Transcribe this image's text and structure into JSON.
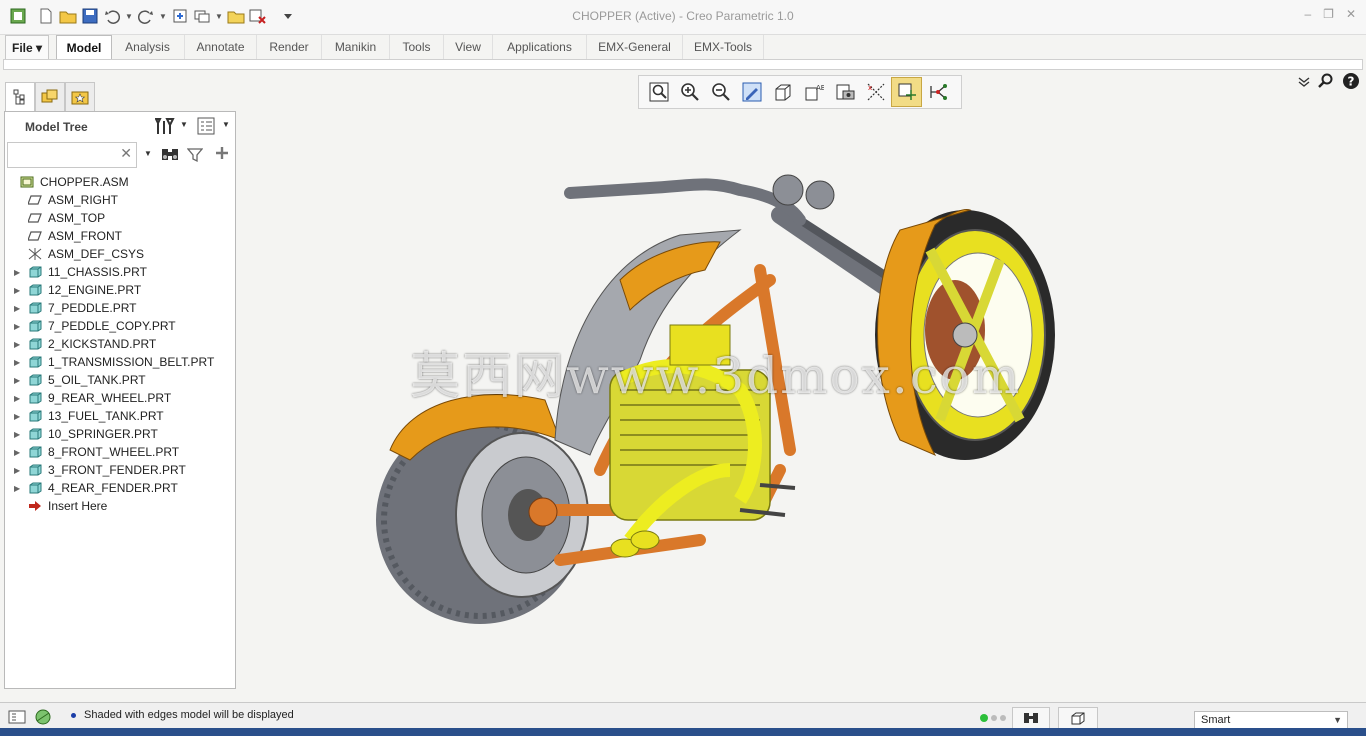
{
  "window": {
    "title": "CHOPPER (Active) - Creo Parametric 1.0"
  },
  "quick_access": {
    "icons": [
      "app-icon",
      "new-icon",
      "open-icon",
      "save-icon",
      "undo-icon",
      "redo-icon",
      "regenerate-icon",
      "windows-icon",
      "open-folder-icon",
      "close-window-icon",
      "customize-icon"
    ]
  },
  "ribbon": {
    "tabs": [
      "File",
      "Model",
      "Analysis",
      "Annotate",
      "Render",
      "Manikin",
      "Tools",
      "View",
      "Applications",
      "EMX-General",
      "EMX-Tools"
    ],
    "active_tab": "Model"
  },
  "navigator": {
    "title": "Model Tree",
    "search_placeholder": "",
    "items": [
      {
        "label": "CHOPPER.ASM",
        "type": "assembly",
        "expandable": false,
        "indent": 0
      },
      {
        "label": "ASM_RIGHT",
        "type": "datum-plane",
        "expandable": false,
        "indent": 1
      },
      {
        "label": "ASM_TOP",
        "type": "datum-plane",
        "expandable": false,
        "indent": 1
      },
      {
        "label": "ASM_FRONT",
        "type": "datum-plane",
        "expandable": false,
        "indent": 1
      },
      {
        "label": "ASM_DEF_CSYS",
        "type": "csys",
        "expandable": false,
        "indent": 1
      },
      {
        "label": "11_CHASSIS.PRT",
        "type": "part",
        "expandable": true,
        "indent": 1
      },
      {
        "label": "12_ENGINE.PRT",
        "type": "part",
        "expandable": true,
        "indent": 1
      },
      {
        "label": "7_PEDDLE.PRT",
        "type": "part",
        "expandable": true,
        "indent": 1
      },
      {
        "label": "7_PEDDLE_COPY.PRT",
        "type": "part",
        "expandable": true,
        "indent": 1
      },
      {
        "label": "2_KICKSTAND.PRT",
        "type": "part",
        "expandable": true,
        "indent": 1
      },
      {
        "label": "1_TRANSMISSION_BELT.PRT",
        "type": "part",
        "expandable": true,
        "indent": 1
      },
      {
        "label": "5_OIL_TANK.PRT",
        "type": "part",
        "expandable": true,
        "indent": 1
      },
      {
        "label": "9_REAR_WHEEL.PRT",
        "type": "part",
        "expandable": true,
        "indent": 1
      },
      {
        "label": "13_FUEL_TANK.PRT",
        "type": "part",
        "expandable": true,
        "indent": 1
      },
      {
        "label": "10_SPRINGER.PRT",
        "type": "part",
        "expandable": true,
        "indent": 1
      },
      {
        "label": "8_FRONT_WHEEL.PRT",
        "type": "part",
        "expandable": true,
        "indent": 1
      },
      {
        "label": "3_FRONT_FENDER.PRT",
        "type": "part",
        "expandable": true,
        "indent": 1
      },
      {
        "label": "4_REAR_FENDER.PRT",
        "type": "part",
        "expandable": true,
        "indent": 1
      },
      {
        "label": "Insert Here",
        "type": "insert",
        "expandable": false,
        "indent": 1
      }
    ]
  },
  "graphics_toolbar": {
    "buttons": [
      "refit-icon",
      "zoom-in-icon",
      "zoom-out-icon",
      "repaint-icon",
      "display-style-icon",
      "saved-views-icon",
      "view-manager-icon",
      "datum-display-icon",
      "spin-center-icon",
      "annotation-display-icon"
    ],
    "active_button": "spin-center-icon"
  },
  "watermark": {
    "text": "莫西网www.3dmox.com"
  },
  "status": {
    "message": "Shaded with edges model will be displayed",
    "selection_filter": "Smart"
  },
  "colors": {
    "accent": "#f2dc86",
    "frame_orange": "#d9782a",
    "engine_yellow": "#e8e020",
    "fender_orange": "#e69a1a",
    "tire_gray": "#7c7f86"
  }
}
